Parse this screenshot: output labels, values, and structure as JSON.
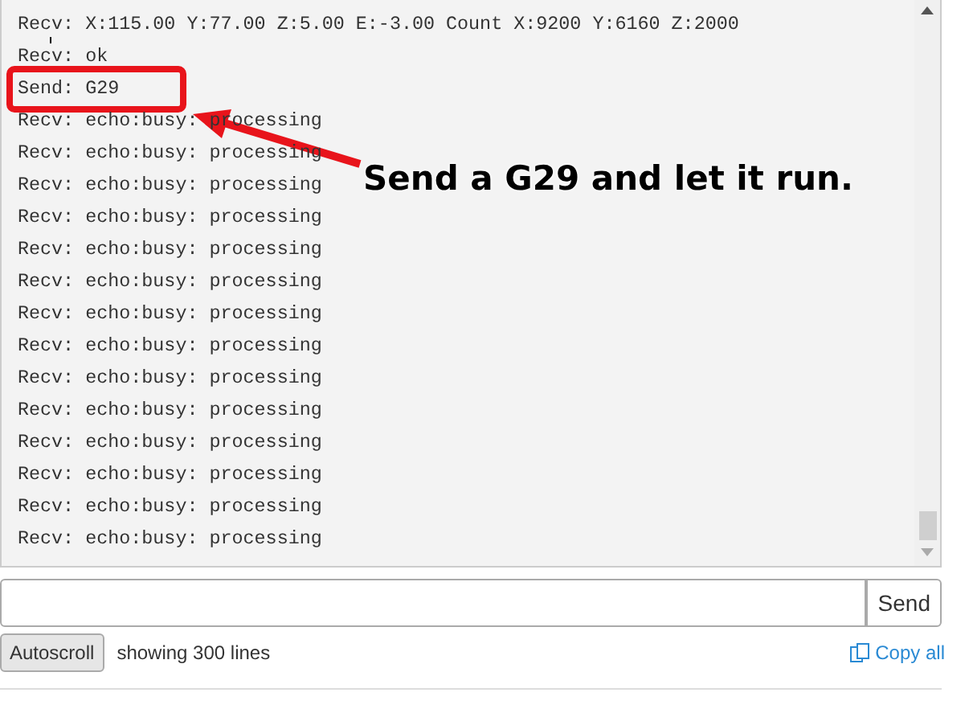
{
  "console": {
    "lines": [
      {
        "kind": "recv",
        "text": "Recv: X:115.00 Y:77.00 Z:5.00 E:-3.00 Count X:9200 Y:6160 Z:2000"
      },
      {
        "kind": "recv",
        "text": "Recv: ok"
      },
      {
        "kind": "send",
        "text": "Send: G29"
      },
      {
        "kind": "recv",
        "text": "Recv: echo:busy: processing"
      },
      {
        "kind": "recv",
        "text": "Recv: echo:busy: processing"
      },
      {
        "kind": "recv",
        "text": "Recv: echo:busy: processing"
      },
      {
        "kind": "recv",
        "text": "Recv: echo:busy: processing"
      },
      {
        "kind": "recv",
        "text": "Recv: echo:busy: processing"
      },
      {
        "kind": "recv",
        "text": "Recv: echo:busy: processing"
      },
      {
        "kind": "recv",
        "text": "Recv: echo:busy: processing"
      },
      {
        "kind": "recv",
        "text": "Recv: echo:busy: processing"
      },
      {
        "kind": "recv",
        "text": "Recv: echo:busy: processing"
      },
      {
        "kind": "recv",
        "text": "Recv: echo:busy: processing"
      },
      {
        "kind": "recv",
        "text": "Recv: echo:busy: processing"
      },
      {
        "kind": "recv",
        "text": "Recv: echo:busy: processing"
      },
      {
        "kind": "recv",
        "text": "Recv: echo:busy: processing"
      },
      {
        "kind": "recv",
        "text": "Recv: echo:busy: processing"
      }
    ]
  },
  "annotation": {
    "text": "Send a G29 and let it run."
  },
  "command": {
    "button": "Send"
  },
  "footer": {
    "autoscroll": "Autoscroll",
    "status": "showing 300 lines",
    "copy": "Copy all"
  }
}
